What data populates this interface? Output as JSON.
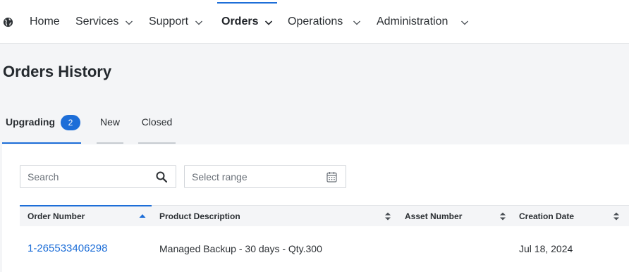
{
  "nav": {
    "home": "Home",
    "services": "Services",
    "support": "Support",
    "orders": "Orders",
    "operations": "Operations",
    "administration": "Administration"
  },
  "page_title": "Orders History",
  "tabs": [
    {
      "label": "Upgrading",
      "badge": "2"
    },
    {
      "label": "New"
    },
    {
      "label": "Closed"
    }
  ],
  "filters": {
    "search_placeholder": "Search",
    "range_placeholder": "Select range"
  },
  "table": {
    "columns": [
      "Order Number",
      "Product Description",
      "Asset Number",
      "Creation Date"
    ],
    "rows": [
      {
        "order_number": "1-265533406298",
        "product_description": "Managed Backup - 30 days - Qty.300",
        "asset_number": "",
        "creation_date": "Jul 18, 2024"
      }
    ]
  },
  "colors": {
    "accent": "#1d6ed8",
    "link": "#1d6ed8"
  },
  "icons": [
    "globe-icon",
    "chevron-down-icon",
    "search-icon",
    "calendar-icon",
    "sort-ascending-icon",
    "sort-icon"
  ]
}
